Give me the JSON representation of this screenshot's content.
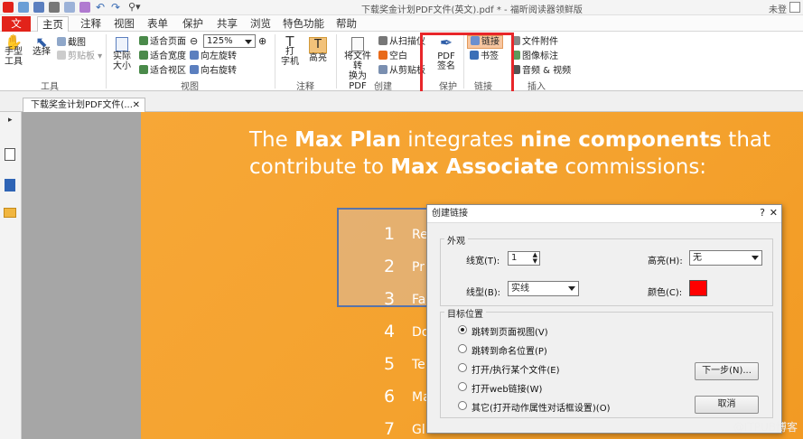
{
  "window": {
    "title": "下载奖金计划PDF文件(英文).pdf * - 福昕阅读器领鲜版",
    "login": "未登"
  },
  "menu": [
    "文件",
    "主页",
    "注释",
    "视图",
    "表单",
    "保护",
    "共享",
    "浏览",
    "特色功能",
    "帮助"
  ],
  "ribbon": {
    "tools": {
      "hand": "手型\n工具",
      "select": "选择",
      "snapshot": "截图",
      "clipboard": "剪贴板",
      "group": "工具"
    },
    "view": {
      "actual": "实际\n大小",
      "fit_page": "适合页面",
      "fit_width": "适合宽度",
      "fit_visible": "适合视区",
      "zoom": "125%",
      "rotate_left": "向左旋转",
      "rotate_right": "向右旋转",
      "group": "视图"
    },
    "comment": {
      "typewriter": "打\n字机",
      "highlight": "高亮",
      "group": "注释"
    },
    "create": {
      "convert": "将文件转\n换为PDF",
      "from_scanner": "从扫描仪",
      "blank": "空白",
      "from_clipboard": "从剪贴板",
      "group": "创建"
    },
    "protect": {
      "pdf_sign": "PDF\n签名",
      "group": "保护"
    },
    "links": {
      "link": "链接",
      "bookmark": "书签",
      "group": "链接"
    },
    "insert": {
      "attachment": "文件附件",
      "image": "图像标注",
      "audio_video": "音频 & 视频",
      "group": "插入"
    }
  },
  "tab": {
    "label": "下载奖金计划PDF文件(..."
  },
  "doc": {
    "headline": [
      [
        {
          "t": "The ",
          "b": false
        },
        {
          "t": "Max Plan",
          "b": true
        },
        {
          "t": " integrates ",
          "b": false
        },
        {
          "t": "nine components",
          "b": true
        },
        {
          "t": " that",
          "b": false
        }
      ],
      [
        {
          "t": "contribute to ",
          "b": false
        },
        {
          "t": "Max Associate",
          "b": true
        },
        {
          "t": " commissions:",
          "b": false
        }
      ]
    ],
    "items": [
      {
        "n": "1",
        "t": "Re"
      },
      {
        "n": "2",
        "t": "Pr"
      },
      {
        "n": "3",
        "t": "Fa"
      },
      {
        "n": "4",
        "t": "Do"
      },
      {
        "n": "5",
        "t": "Te"
      },
      {
        "n": "6",
        "t": "Ma"
      },
      {
        "n": "7",
        "t": "Gl"
      }
    ]
  },
  "dialog": {
    "title": "创建链接",
    "appearance": {
      "legend": "外观",
      "width_label": "线宽(T):",
      "width_value": "1",
      "style_label": "线型(B):",
      "style_value": "实线",
      "highlight_label": "高亮(H):",
      "highlight_value": "无",
      "color_label": "颜色(C):",
      "color_value": "#ff0000"
    },
    "target": {
      "legend": "目标位置",
      "options": [
        "跳转到页面视图(V)",
        "跳转到命名位置(P)",
        "打开/执行某个文件(E)",
        "打开web链接(W)",
        "其它(打开动作属性对话框设置)(O)"
      ],
      "selected": 0
    },
    "next_button": "下一步(N)...",
    "cancel_button": "取消"
  },
  "watermark": "@ITPUB博客"
}
